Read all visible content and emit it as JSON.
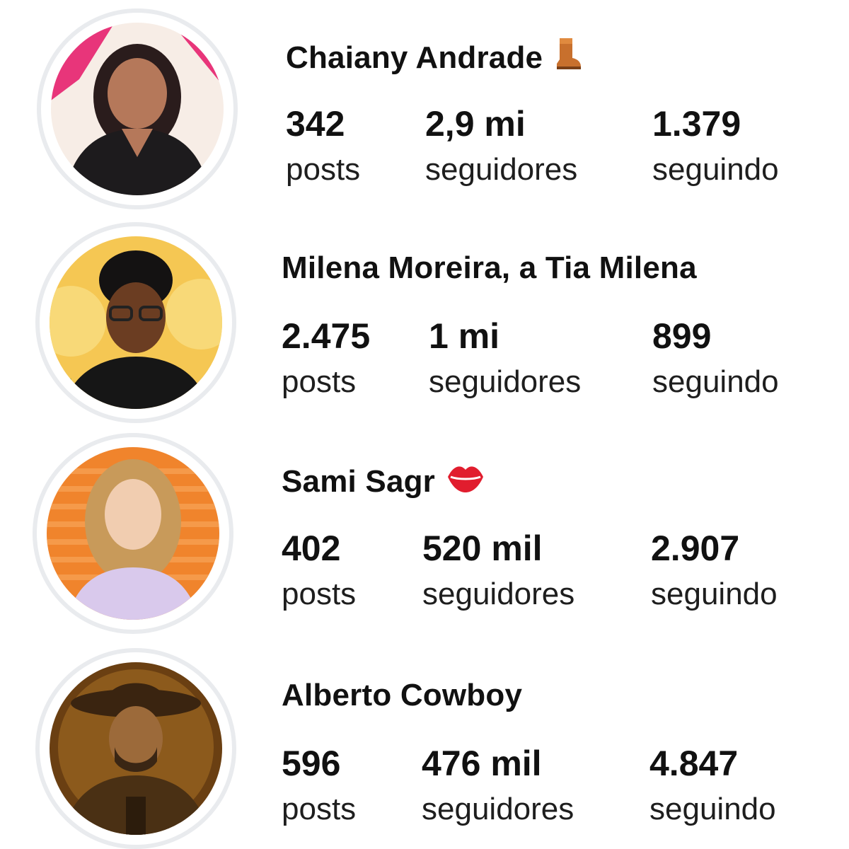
{
  "profiles": [
    {
      "name": "Chaiany Andrade",
      "emoji": "boot-icon",
      "posts": "342",
      "followers": "2,9 mi",
      "following": "1.379",
      "posts_label": "posts",
      "followers_label": "seguidores",
      "following_label": "seguindo"
    },
    {
      "name": "Milena Moreira, a Tia Milena",
      "emoji": "",
      "posts": "2.475",
      "followers": "1 mi",
      "following": "899",
      "posts_label": "posts",
      "followers_label": "seguidores",
      "following_label": "seguindo"
    },
    {
      "name": "Sami Sagr",
      "emoji": "kiss-lips-icon",
      "posts": "402",
      "followers": "520 mil",
      "following": "2.907",
      "posts_label": "posts",
      "followers_label": "seguidores",
      "following_label": "seguindo"
    },
    {
      "name": "Alberto Cowboy",
      "emoji": "",
      "posts": "596",
      "followers": "476 mil",
      "following": "4.847",
      "posts_label": "posts",
      "followers_label": "seguidores",
      "following_label": "seguindo"
    }
  ]
}
